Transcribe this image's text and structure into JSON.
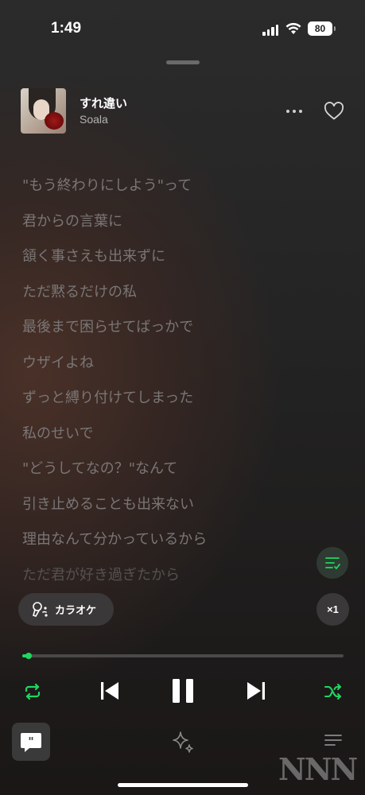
{
  "status_bar": {
    "time": "1:49",
    "battery": "80"
  },
  "track": {
    "title": "すれ違い",
    "artist": "Soala"
  },
  "lyrics": [
    "\"もう終わりにしよう\"って",
    "君からの言葉に",
    "頷く事さえも出来ずに",
    "ただ黙るだけの私",
    "最後まで困らせてばっかで",
    "ウザイよね",
    "ずっと縛り付けてしまった",
    "私のせいで",
    "\"どうしてなの？\"なんて",
    "引き止めることも出来ない",
    "理由なんて分かっているから",
    "ただ君が好き過ぎたから"
  ],
  "karaoke": {
    "label": "カラオケ"
  },
  "speed": {
    "label": "×1"
  },
  "playback": {
    "progress_fraction": 0.02
  },
  "colors": {
    "accent": "#1ed760",
    "background": "#242424"
  },
  "icons": {
    "more": "more-icon",
    "like": "heart-icon",
    "queue": "queue-icon",
    "karaoke": "microphone-icon",
    "repeat": "repeat-icon",
    "previous": "previous-icon",
    "pause": "pause-icon",
    "next": "next-icon",
    "shuffle": "shuffle-icon",
    "chat": "chat-icon",
    "sparkle": "sparkle-icon",
    "list": "list-icon"
  },
  "watermark": "NNN"
}
